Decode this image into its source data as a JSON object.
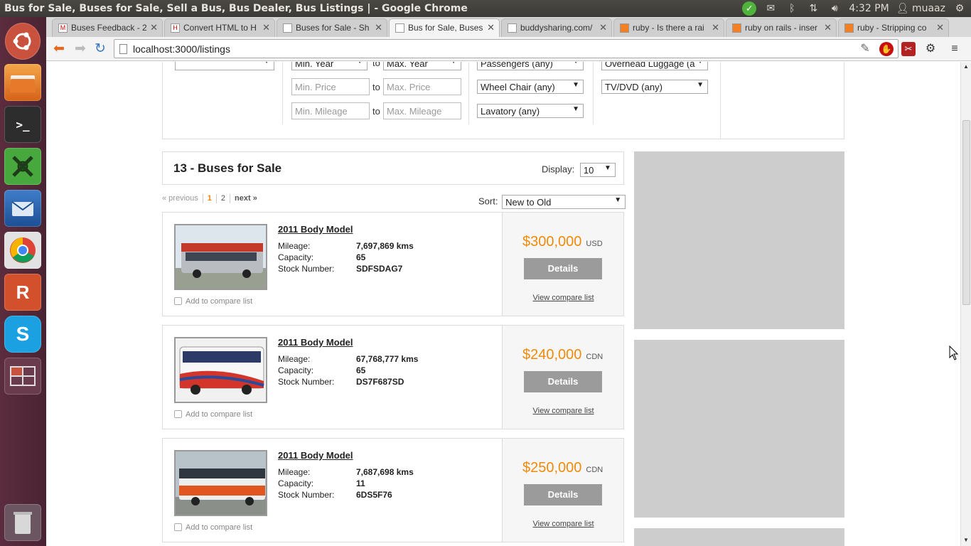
{
  "window": {
    "title": "Bus for Sale, Buses for Sale, Sell a Bus, Bus Dealer, Bus Listings | - Google Chrome"
  },
  "tray": {
    "time": "4:32 PM",
    "user": "muaaz"
  },
  "launcher": {
    "items": [
      "ubuntu-dash-icon",
      "files-icon",
      "terminal-icon",
      "xmind-icon",
      "thunderbird-icon",
      "chrome-icon",
      "rubymine-icon",
      "skype-icon",
      "workspaces-icon",
      "trash-icon"
    ]
  },
  "tabs": [
    {
      "label": "Buses Feedback - 2",
      "favicon": "M"
    },
    {
      "label": "Convert HTML to H",
      "favicon": "H"
    },
    {
      "label": "Buses for Sale - Sh",
      "favicon": ""
    },
    {
      "label": "Bus for Sale, Buses",
      "favicon": ""
    },
    {
      "label": "buddysharing.com/",
      "favicon": ""
    },
    {
      "label": "ruby - Is there a rai",
      "favicon": ""
    },
    {
      "label": "ruby on rails - inser",
      "favicon": ""
    },
    {
      "label": "ruby - Stripping co",
      "favicon": ""
    }
  ],
  "address_bar": {
    "url": "localhost:3000/listings"
  },
  "filters": {
    "col1_select": "",
    "min_year": "Min. Year",
    "max_year": "Max. Year",
    "min_price": "Min. Price",
    "max_price": "Max. Price",
    "min_mileage": "Min. Mileage",
    "max_mileage": "Max. Mileage",
    "to": "to",
    "passengers": "Passengers (any)",
    "wheel_chair": "Wheel Chair (any)",
    "lavatory": "Lavatory (any)",
    "overhead_luggage": "Overhead Luggage (a",
    "tv_dvd": "TV/DVD (any)"
  },
  "results": {
    "heading": "13 - Buses for Sale",
    "display_label": "Display:",
    "display_value": "10",
    "sort_label": "Sort:",
    "sort_value": "New to Old"
  },
  "pager": {
    "previous": "« previous",
    "page1": "1",
    "page2": "2",
    "next": "next »"
  },
  "labels": {
    "mileage": "Mileage:",
    "capacity": "Capacity:",
    "stock": "Stock Number:",
    "add_compare": "Add to compare list",
    "details": "Details",
    "view_compare": "View compare list"
  },
  "listings": [
    {
      "title": "2011 Body Model",
      "mileage": "7,697,869 kms",
      "capacity": "65",
      "stock": "SDFSDAG7",
      "price": "$300,000",
      "currency": "USD"
    },
    {
      "title": "2011 Body Model",
      "mileage": "67,768,777 kms",
      "capacity": "65",
      "stock": "DS7F687SD",
      "price": "$240,000",
      "currency": "CDN"
    },
    {
      "title": "2011 Body Model",
      "mileage": "7,687,698 kms",
      "capacity": "11",
      "stock": "6DS5F76",
      "price": "$250,000",
      "currency": "CDN"
    }
  ]
}
